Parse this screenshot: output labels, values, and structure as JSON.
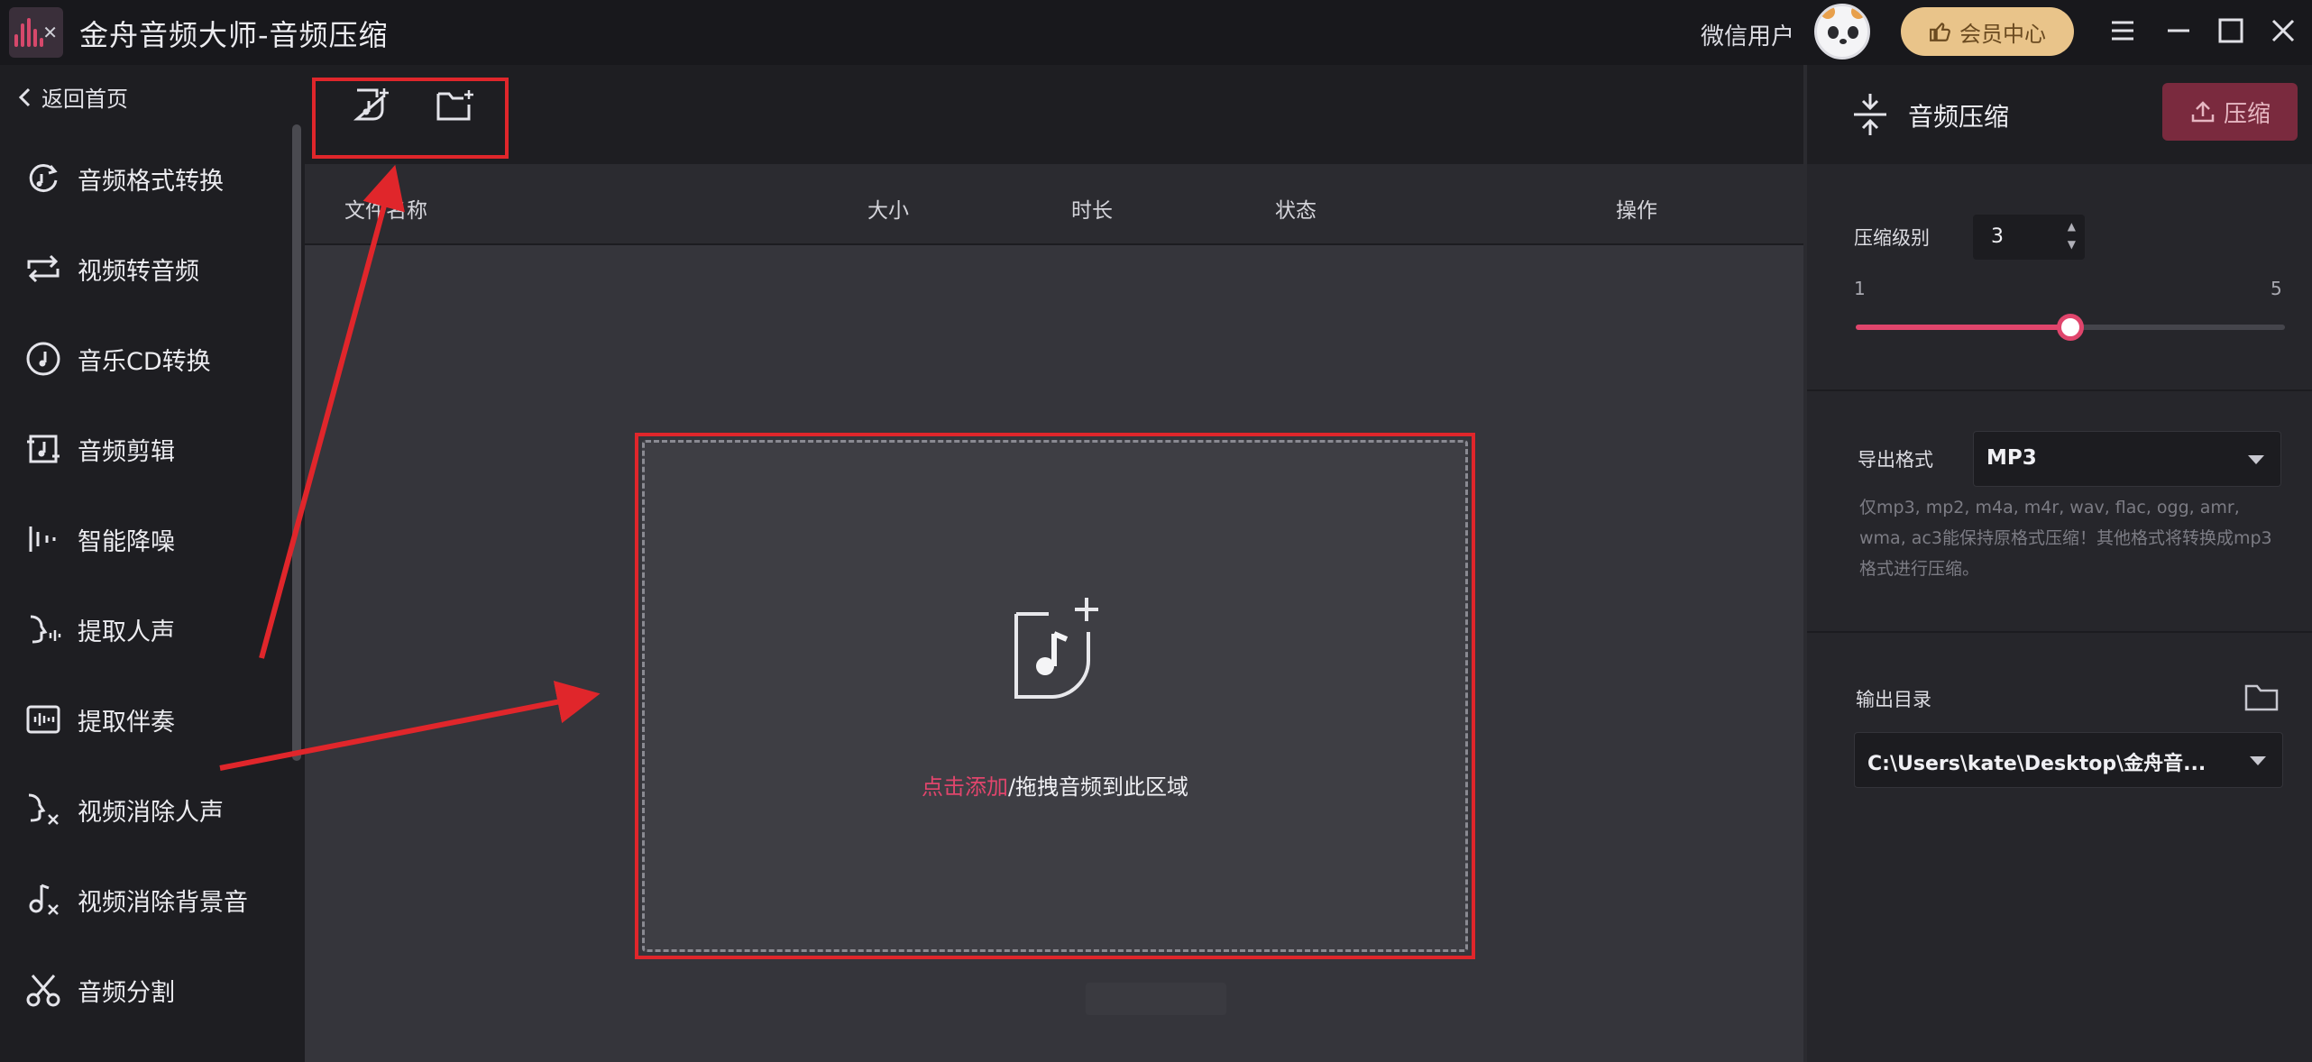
{
  "titlebar": {
    "app_title": "金舟音频大师-音频压缩",
    "user_name": "微信用户",
    "vip_label": "会员中心"
  },
  "sidebar": {
    "back_label": "返回首页",
    "items": [
      {
        "label": "音频格式转换",
        "icon": "audio-convert-icon"
      },
      {
        "label": "视频转音频",
        "icon": "video-to-audio-icon"
      },
      {
        "label": "音乐CD转换",
        "icon": "cd-icon"
      },
      {
        "label": "音频剪辑",
        "icon": "audio-edit-icon"
      },
      {
        "label": "智能降噪",
        "icon": "denoise-icon"
      },
      {
        "label": "提取人声",
        "icon": "extract-vocal-icon"
      },
      {
        "label": "提取伴奏",
        "icon": "extract-accompaniment-icon"
      },
      {
        "label": "视频消除人声",
        "icon": "remove-vocal-icon"
      },
      {
        "label": "视频消除背景音",
        "icon": "remove-bgm-icon"
      },
      {
        "label": "音频分割",
        "icon": "scissors-icon"
      }
    ]
  },
  "table": {
    "columns": [
      "文件名称",
      "大小",
      "时长",
      "状态",
      "操作"
    ]
  },
  "dropzone": {
    "link_text": "点击添加",
    "rest_text": "/拖拽音频到此区域"
  },
  "panel": {
    "title": "音频压缩",
    "compress_button": "压缩",
    "level_label": "压缩级别",
    "level_value": "3",
    "level_min": "1",
    "level_max": "5",
    "level_fraction": 0.5,
    "format_label": "导出格式",
    "format_value": "MP3",
    "format_hint": "仅mp3, mp2, m4a, m4r, wav, flac, ogg, amr, wma, ac3能保持原格式压缩！其他格式将转换成mp3格式进行压缩。",
    "output_label": "输出目录",
    "output_value": "C:\\Users\\kate\\Desktop\\金舟音..."
  },
  "colors": {
    "accent": "#e0456c",
    "annotation": "#e0262b",
    "vip": "#e9c48a"
  }
}
